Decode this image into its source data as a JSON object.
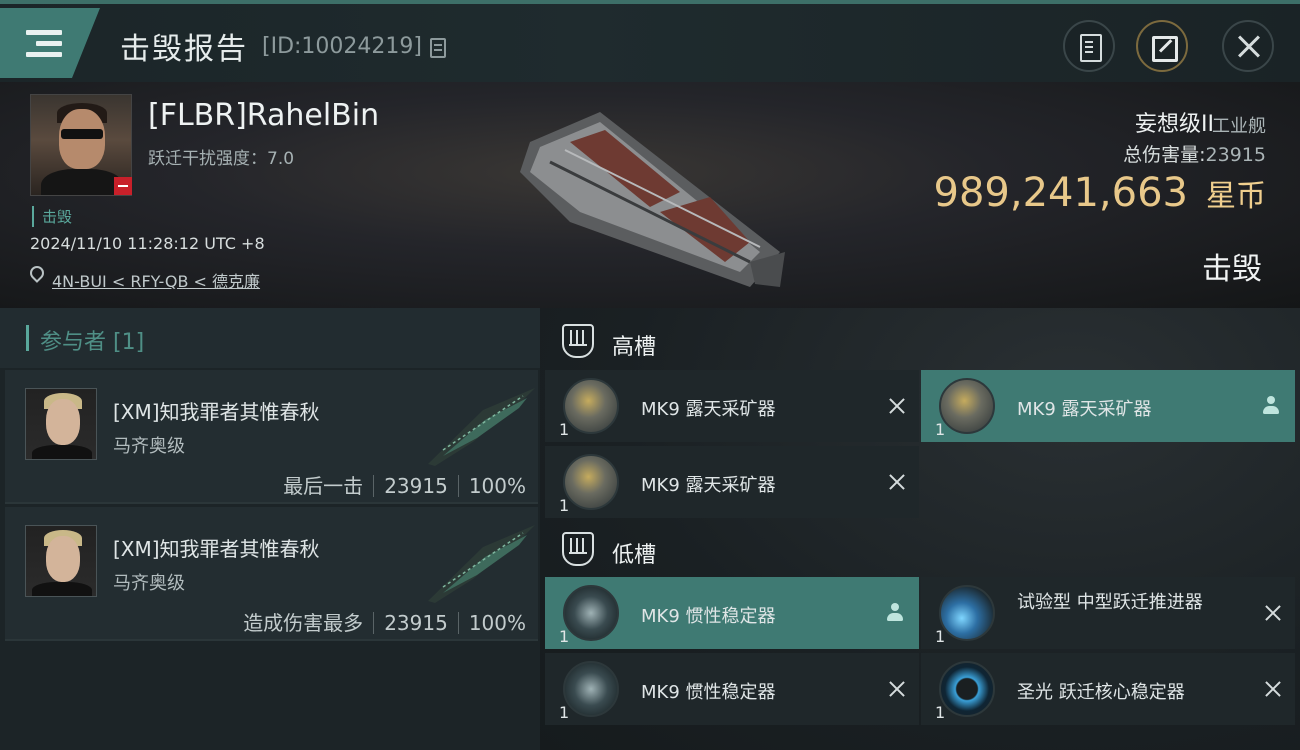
{
  "header": {
    "title": "击毁报告",
    "report_id": "[ID:10024219]"
  },
  "victim": {
    "name": "[FLBR]RahelBin",
    "warp_disrupt": "跃迁干扰强度：7.0",
    "status_tag": "击毁",
    "time": "2024/11/10 11:28:12 UTC +8",
    "location": "4N-BUI < RFY-QB < 德克廉",
    "ship_name": "妄想级II",
    "ship_class": "工业舰",
    "total_damage_label": "总伤害量:",
    "total_damage_value": "23915",
    "isk_value": "989,241,663",
    "isk_unit": "星币",
    "outcome": "击毁"
  },
  "participants": {
    "header": "参与者 [1]",
    "items": [
      {
        "name": "[XM]知我罪者其惟春秋",
        "ship": "马齐奥级",
        "role": "最后一击",
        "damage": "23915",
        "percent": "100%"
      },
      {
        "name": "[XM]知我罪者其惟春秋",
        "ship": "马齐奥级",
        "role": "造成伤害最多",
        "damage": "23915",
        "percent": "100%"
      }
    ]
  },
  "fitting": {
    "high_label": "高槽",
    "low_label": "低槽",
    "high": [
      {
        "name": "MK9 露天采矿器",
        "qty": "1",
        "state": "destroyed"
      },
      {
        "name": "MK9 露天采矿器",
        "qty": "1",
        "state": "dropped"
      },
      {
        "name": "MK9 露天采矿器",
        "qty": "1",
        "state": "destroyed"
      }
    ],
    "low": [
      {
        "name": "MK9 惯性稳定器",
        "qty": "1",
        "state": "dropped"
      },
      {
        "name": "试验型 中型跃迁推进器",
        "qty": "1",
        "state": "destroyed"
      },
      {
        "name": "MK9 惯性稳定器",
        "qty": "1",
        "state": "destroyed"
      },
      {
        "name": "圣光 跃迁核心稳定器",
        "qty": "1",
        "state": "destroyed"
      }
    ]
  },
  "colors": {
    "accent": "#3f7a73",
    "isk": "#e8c88a",
    "kill_red": "#c8202a"
  }
}
